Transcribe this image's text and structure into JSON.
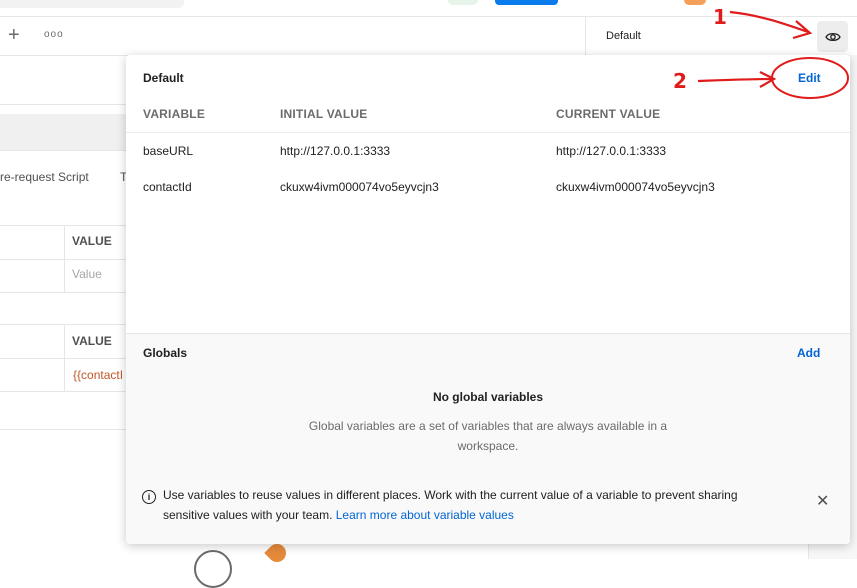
{
  "tabs": {
    "new_tab_icon": "plus-icon",
    "more_icon": "ellipsis-icon"
  },
  "environment": {
    "selected": "Default",
    "quick_look_icon": "eye-icon"
  },
  "background": {
    "request_tabs": [
      "re-request Script",
      "T"
    ],
    "params_table": {
      "header": "VALUE",
      "placeholder": "Value"
    },
    "headers_table": {
      "header": "VALUE",
      "value": "{{contactI"
    }
  },
  "popover": {
    "environment_title": "Default",
    "edit_label": "Edit",
    "columns": [
      "VARIABLE",
      "INITIAL VALUE",
      "CURRENT VALUE"
    ],
    "variables": [
      {
        "name": "baseURL",
        "initial": "http://127.0.0.1:3333",
        "current": "http://127.0.0.1:3333"
      },
      {
        "name": "contactId",
        "initial": "ckuxw4ivm000074vo5eyvcjn3",
        "current": "ckuxw4ivm000074vo5eyvcjn3"
      }
    ],
    "globals": {
      "title": "Globals",
      "add_label": "Add",
      "empty_title": "No global variables",
      "empty_desc": "Global variables are a set of variables that are always available in a workspace."
    },
    "info": {
      "text": "Use variables to reuse values in different places. Work with the current value of a variable to prevent sharing sensitive values with your team.",
      "link": "Learn more about variable values",
      "close_icon": "close-icon"
    }
  },
  "annotations": {
    "step1": "1",
    "step2": "2",
    "color": "#e01b1b"
  },
  "colors": {
    "accent": "#0265d2",
    "background_value": "#c0572a"
  }
}
